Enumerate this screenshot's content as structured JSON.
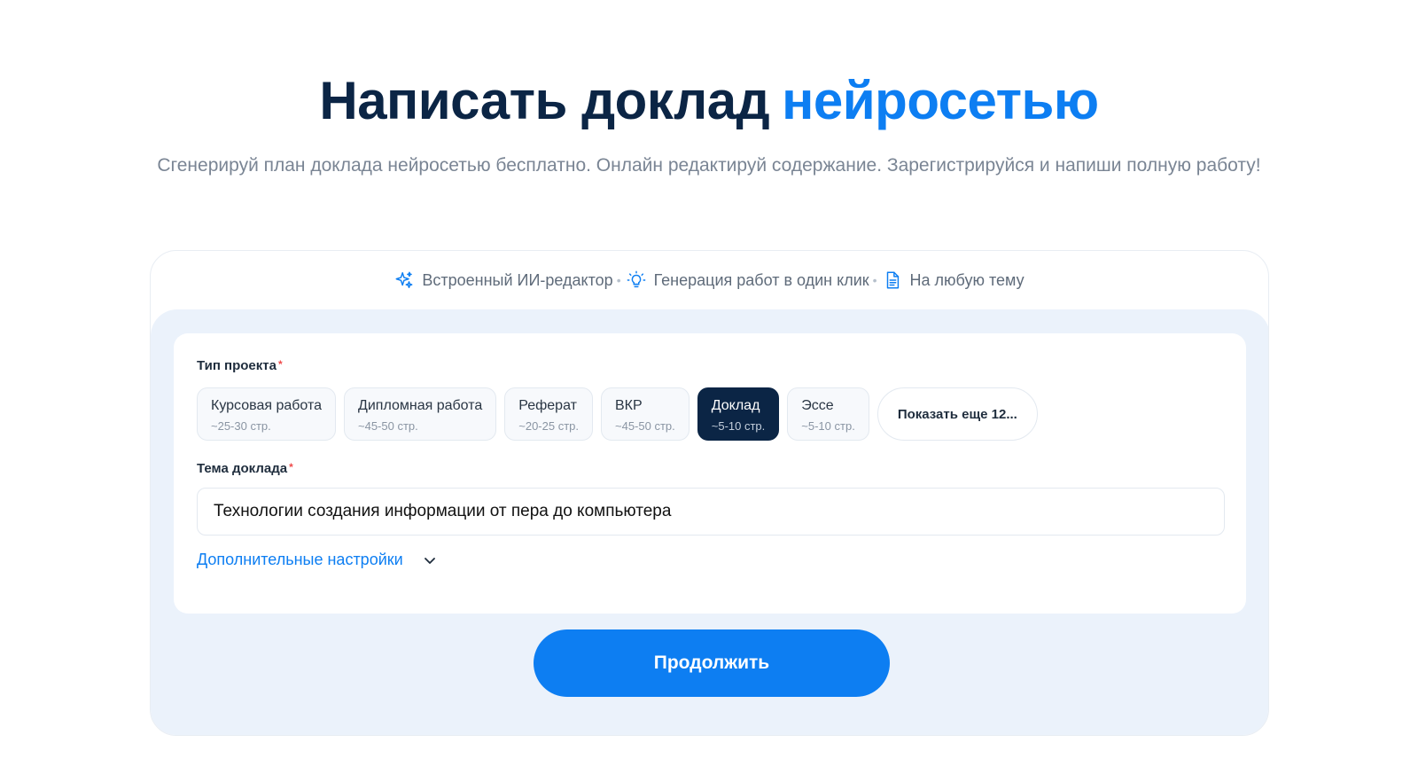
{
  "hero": {
    "title_main": "Написать доклад",
    "title_accent": "нейросетью",
    "subtitle": "Сгенерируй план доклада нейросетью бесплатно. Онлайн редактируй содержание. Зарегистрируйся и напиши полную работу!"
  },
  "features": [
    {
      "label": "Встроенный ИИ-редактор",
      "icon": "sparkle-icon"
    },
    {
      "label": "Генерация работ в один клик",
      "icon": "lightbulb-icon"
    },
    {
      "label": "На любую тему",
      "icon": "document-icon"
    }
  ],
  "form": {
    "project_type_label": "Тип проекта",
    "required_mark": "*",
    "types": [
      {
        "name": "Курсовая работа",
        "pages": "~25-30 стр."
      },
      {
        "name": "Дипломная работа",
        "pages": "~45-50 стр."
      },
      {
        "name": "Реферат",
        "pages": "~20-25 стр."
      },
      {
        "name": "ВКР",
        "pages": "~45-50 стр."
      },
      {
        "name": "Доклад",
        "pages": "~5-10 стр."
      },
      {
        "name": "Эссе",
        "pages": "~5-10 стр."
      }
    ],
    "selected_type": "Доклад",
    "show_more": "Показать еще 12...",
    "topic_label": "Тема доклада",
    "topic_value": "Технологии создания информации от пера до компьютера",
    "extra_settings": "Дополнительные настройки"
  },
  "continue_button": "Продолжить",
  "colors": {
    "accent": "#0d7ef2",
    "dark": "#0b2545",
    "panel_bg": "#ebf2fb",
    "required": "#ef4b4b"
  }
}
